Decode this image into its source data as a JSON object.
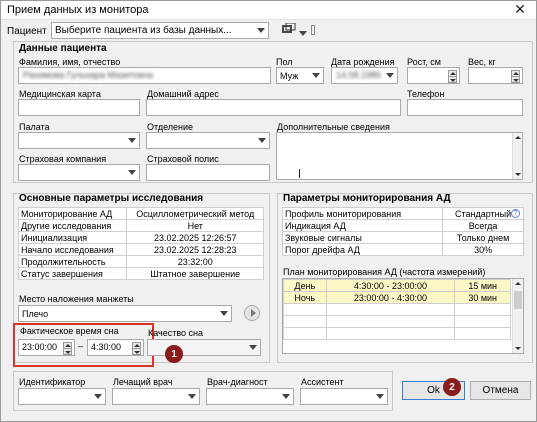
{
  "window": {
    "title": "Прием данных из монитора",
    "close_glyph": "✕"
  },
  "toolbar": {
    "patient_label": "Пациент",
    "patient_select_value": "Выберите пациента из базы данных..."
  },
  "patient_section": {
    "title": "Данные пациента",
    "fio_label": "Фамилия, имя, отчество",
    "fio_value": "Рахимова Гульнара Мазитовна",
    "sex_label": "Пол",
    "sex_value": "Муж",
    "birth_label": "Дата рождения",
    "birth_value": "14.08.1986",
    "height_label": "Рост, см",
    "weight_label": "Вес, кг",
    "med_card_label": "Медицинская карта",
    "address_label": "Домашний адрес",
    "phone_label": "Телефон",
    "ward_label": "Палата",
    "department_label": "Отделение",
    "extra_label": "Дополнительные сведения",
    "insurance_label": "Страховая компания",
    "policy_label": "Страховой полис"
  },
  "study_section": {
    "title": "Основные параметры исследования",
    "rows": [
      {
        "k": "Мониторирование АД",
        "v": "Осциллометрический метод"
      },
      {
        "k": "Другие исследования",
        "v": "Нет"
      },
      {
        "k": "Инициализация",
        "v": "23.02.2025 12:26:57"
      },
      {
        "k": "Начало исследования",
        "v": "23.02.2025 12:28:23"
      },
      {
        "k": "Продолжительность",
        "v": "23:32:00"
      },
      {
        "k": "Статус завершения",
        "v": "Штатное завершение"
      }
    ],
    "cuff_label": "Место наложения манжеты",
    "cuff_value": "Плечо",
    "actual_sleep_label": "Фактическое время сна",
    "sleep_from": "23:00:00",
    "sleep_dash": "–",
    "sleep_to": "4:30:00",
    "sleep_quality_label": "Качество сна"
  },
  "bp_section": {
    "title": "Параметры мониторирования АД",
    "rows": [
      {
        "k": "Профиль мониторирования",
        "v": "Стандартный"
      },
      {
        "k": "Индикация АД",
        "v": "Всегда"
      },
      {
        "k": "Звуковые сигналы",
        "v": "Только днем"
      },
      {
        "k": "Порог дрейфа АД",
        "v": "30%"
      }
    ],
    "plan_label": "План мониторирования АД (частота измерений)",
    "plan_rows": [
      {
        "period": "День",
        "range": "4:30:00 - 23:00:00",
        "freq": "15 мин"
      },
      {
        "period": "Ночь",
        "range": "23:00:00 - 4:30:00",
        "freq": "30 мин"
      }
    ]
  },
  "staff": {
    "id_label": "Идентификатор",
    "doctor_label": "Лечащий врач",
    "diag_label": "Врач-диагност",
    "assistant_label": "Ассистент"
  },
  "buttons": {
    "ok": "Ok",
    "cancel": "Отмена"
  },
  "badges": {
    "one": "1",
    "two": "2"
  },
  "colors": {
    "callout_red": "#d9342b",
    "badge": "#8b1a1a",
    "plan_highlight": "#fcf7c6"
  }
}
